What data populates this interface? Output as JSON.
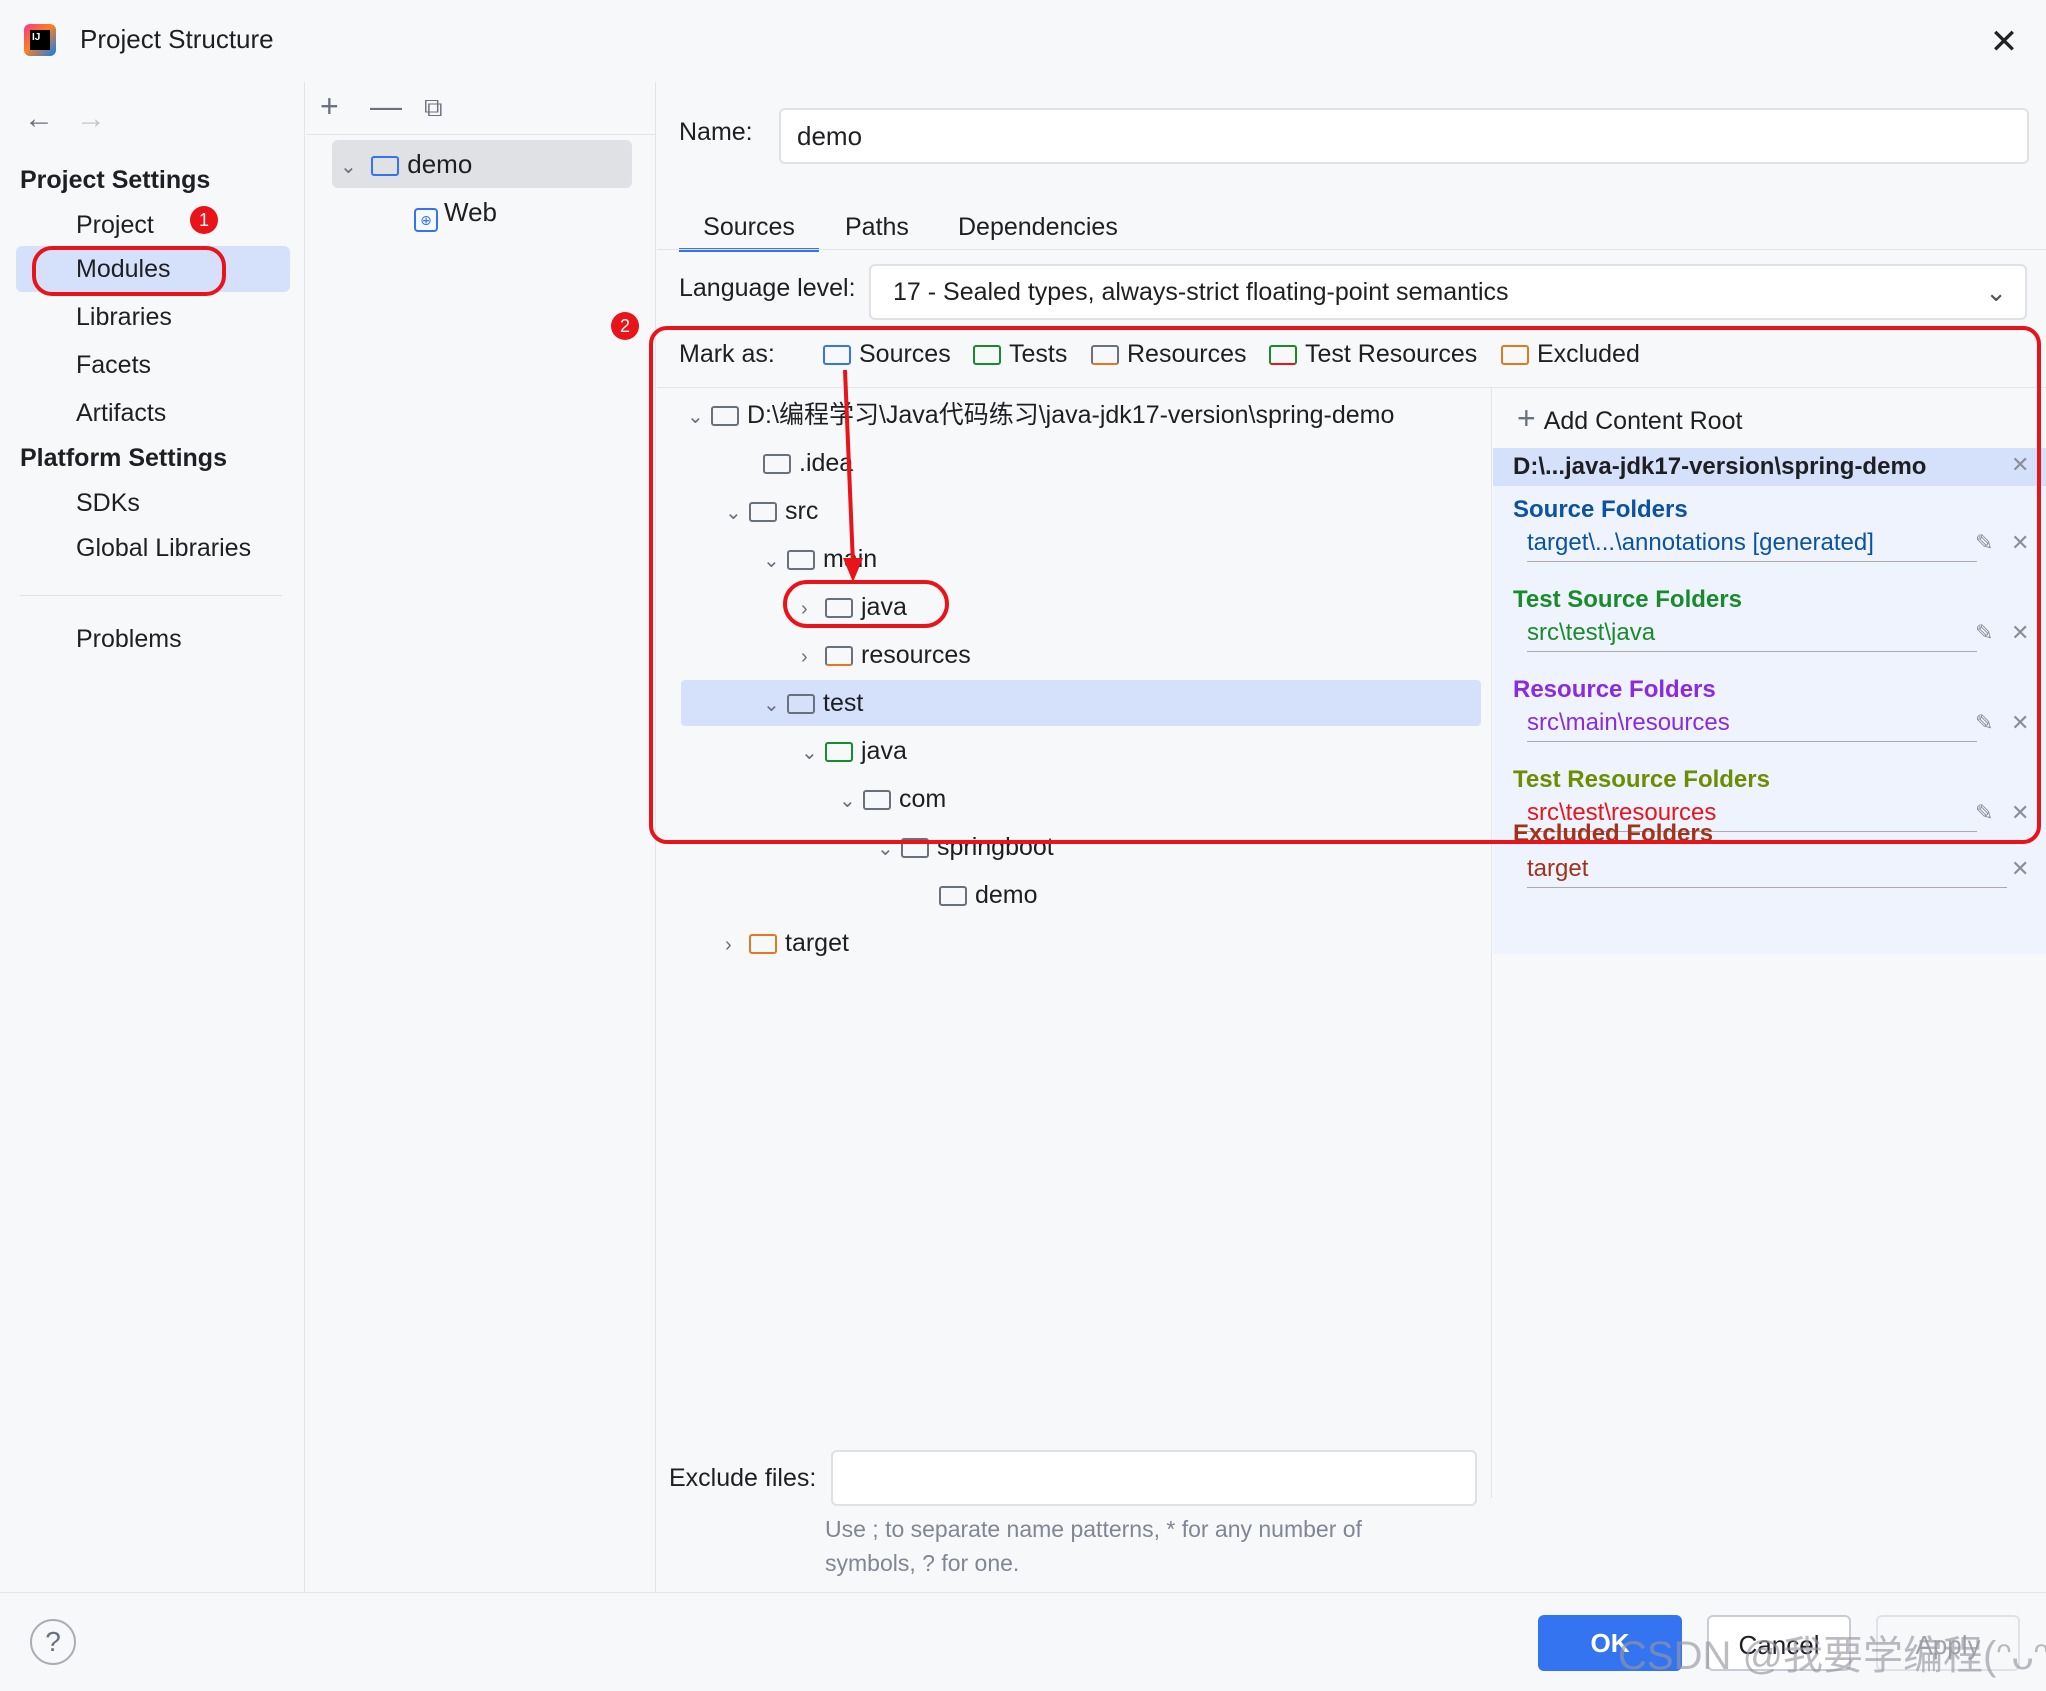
{
  "window": {
    "title": "Project Structure"
  },
  "sidebar": {
    "project_settings_title": "Project Settings",
    "items_project": [
      "Project",
      "Modules",
      "Libraries",
      "Facets",
      "Artifacts"
    ],
    "platform_settings_title": "Platform Settings",
    "items_platform": [
      "SDKs",
      "Global Libraries"
    ],
    "problems": "Problems",
    "selected": "Modules"
  },
  "badges": {
    "one": "1",
    "two": "2"
  },
  "modules_tree": {
    "module": "demo",
    "facet": "Web"
  },
  "module": {
    "name_label": "Name:",
    "name_value": "demo",
    "tabs": [
      "Sources",
      "Paths",
      "Dependencies"
    ],
    "active_tab": "Sources",
    "language_level_label": "Language level:",
    "language_level_value": "17 - Sealed types, always-strict floating-point semantics"
  },
  "mark_as": {
    "label": "Mark as:",
    "options": [
      "Sources",
      "Tests",
      "Resources",
      "Test Resources",
      "Excluded"
    ]
  },
  "file_tree": {
    "root": "D:\\编程学习\\Java代码练习\\java-jdk17-version\\spring-demo",
    "nodes": [
      ".idea",
      "src",
      "main",
      "java",
      "resources",
      "test",
      "java",
      "com",
      "springboot",
      "demo",
      "target"
    ]
  },
  "content_roots": {
    "add_label": "Add Content Root",
    "root_path": "D:\\...java-jdk17-version\\spring-demo",
    "source_title": "Source Folders",
    "source_path": "target\\...\\annotations [generated]",
    "test_source_title": "Test Source Folders",
    "test_source_path": "src\\test\\java",
    "resource_title": "Resource Folders",
    "resource_path": "src\\main\\resources",
    "test_resource_title": "Test Resource Folders",
    "test_resource_path": "src\\test\\resources",
    "excluded_title": "Excluded Folders",
    "excluded_path": "target"
  },
  "exclude": {
    "label": "Exclude files:",
    "value": "",
    "hint_line1": "Use ; to separate name patterns, * for any number of",
    "hint_line2": "symbols, ? for one."
  },
  "buttons": {
    "ok": "OK",
    "cancel": "Cancel",
    "apply": "Apply",
    "help": "?"
  },
  "watermark": "CSDN @我要学编程(ᵔᴗᵔ)",
  "colors": {
    "accent": "#3574f0",
    "selection": "#d5e1fb",
    "annotation_red": "#e8141a",
    "source_blue": "#0b52a3",
    "test_green": "#1a8b2c",
    "resource_purple": "#8a2be2",
    "test_resource_olive": "#6b8e00",
    "excluded_brown": "#a0341a"
  }
}
